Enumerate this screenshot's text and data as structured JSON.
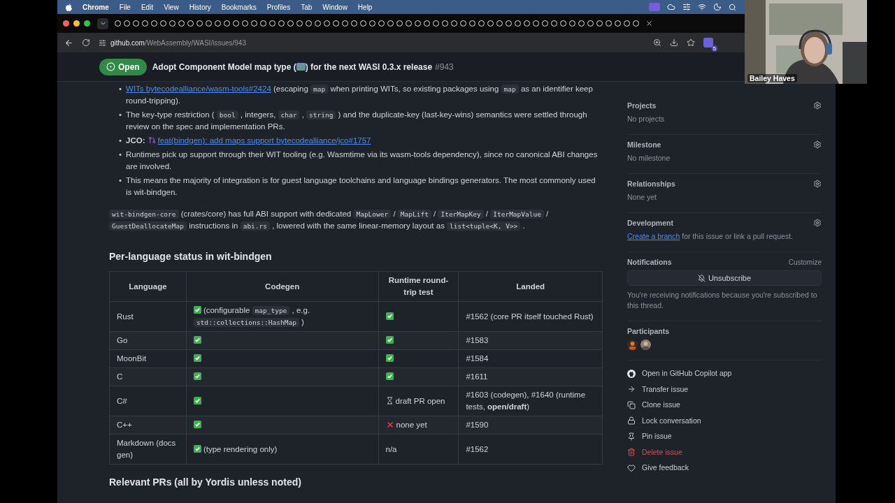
{
  "menubar": {
    "app": "Chrome",
    "menus": [
      "File",
      "Edit",
      "View",
      "History",
      "Bookmarks",
      "Profiles",
      "Tab",
      "Window",
      "Help"
    ]
  },
  "address_bar": {
    "host": "github.com",
    "path": "/WebAssembly/WASI/issues/943",
    "extension_badge": "5"
  },
  "issue": {
    "state": "Open",
    "title_start": "Adopt Component Model map type (",
    "title_end": ") for the next WASI 0.3.x release",
    "number": "#943"
  },
  "bullets": [
    {
      "marker": "•",
      "parts": [
        {
          "kind": "link",
          "text": "WITs bytecodealliance/wasm-tools#2424"
        },
        {
          "kind": "text",
          "text": " (escaping "
        },
        {
          "kind": "code",
          "text": "map"
        },
        {
          "kind": "text",
          "text": " when printing WITs, so existing packages using "
        },
        {
          "kind": "code",
          "text": "map"
        },
        {
          "kind": "text",
          "text": " as an identifier keep round-tripping)."
        }
      ]
    },
    {
      "marker": "•",
      "parts": [
        {
          "kind": "text",
          "text": "The key-type restriction ( "
        },
        {
          "kind": "code",
          "text": "bool"
        },
        {
          "kind": "text",
          "text": " , integers, "
        },
        {
          "kind": "code",
          "text": "char"
        },
        {
          "kind": "text",
          "text": " , "
        },
        {
          "kind": "code",
          "text": "string"
        },
        {
          "kind": "text",
          "text": " ) and the duplicate-key (last-key-wins) semantics were settled through review on the spec and implementation PRs."
        }
      ]
    },
    {
      "marker": "•",
      "parts": [
        {
          "kind": "bold",
          "text": "JCO:"
        },
        {
          "kind": "pr",
          "text": "feat(bindgen): add maps support bytecodealliance/jco#1757"
        }
      ]
    },
    {
      "marker": "•",
      "parts": [
        {
          "kind": "text",
          "text": "Runtimes pick up support through their WIT tooling (e.g. Wasmtime via its wasm-tools dependency), since no canonical ABI changes are involved."
        }
      ]
    },
    {
      "marker": "•",
      "parts": [
        {
          "kind": "text",
          "text": "This means the majority of integration is for guest language toolchains and language bindings generators. The most commonly used is wit-bindgen."
        }
      ]
    }
  ],
  "paragraph": [
    {
      "kind": "code",
      "text": "wit-bindgen-core"
    },
    {
      "kind": "text",
      "text": " (crates/core) has full ABI support with dedicated "
    },
    {
      "kind": "code",
      "text": "MapLower"
    },
    {
      "kind": "text",
      "text": " / "
    },
    {
      "kind": "code",
      "text": "MapLift"
    },
    {
      "kind": "text",
      "text": " / "
    },
    {
      "kind": "code",
      "text": "IterMapKey"
    },
    {
      "kind": "text",
      "text": " / "
    },
    {
      "kind": "code",
      "text": "IterMapValue"
    },
    {
      "kind": "text",
      "text": " / "
    },
    {
      "kind": "code",
      "text": "GuestDeallocateMap"
    },
    {
      "kind": "text",
      "text": " instructions in "
    },
    {
      "kind": "code",
      "text": "abi.rs"
    },
    {
      "kind": "text",
      "text": " , lowered with the same linear-memory layout as "
    },
    {
      "kind": "code",
      "text": "list<tuple<K, V>>"
    },
    {
      "kind": "text",
      "text": " ."
    }
  ],
  "section_heading": "Per-language status in wit-bindgen",
  "table": {
    "columns": [
      "Language",
      "Codegen",
      "Runtime round-trip test",
      "Landed"
    ],
    "rows": [
      {
        "cells": [
          {
            "kind": "plain",
            "parts": [
              {
                "kind": "text",
                "text": "Rust"
              }
            ]
          },
          {
            "kind": "check",
            "parts": [
              {
                "kind": "text",
                "text": "(configurable "
              },
              {
                "kind": "code",
                "text": "map_type"
              },
              {
                "kind": "text",
                "text": " , e.g. "
              },
              {
                "kind": "code",
                "text": "std::collections::HashMap"
              },
              {
                "kind": "text",
                "text": " )"
              }
            ]
          },
          {
            "kind": "check"
          },
          {
            "kind": "plain",
            "parts": [
              {
                "kind": "text",
                "text": "#1562 (core PR itself touched Rust)"
              }
            ]
          }
        ]
      },
      {
        "cells": [
          {
            "kind": "plain",
            "parts": [
              {
                "kind": "text",
                "text": "Go"
              }
            ]
          },
          {
            "kind": "check"
          },
          {
            "kind": "check"
          },
          {
            "kind": "plain",
            "parts": [
              {
                "kind": "text",
                "text": "#1583"
              }
            ]
          }
        ]
      },
      {
        "cells": [
          {
            "kind": "plain",
            "parts": [
              {
                "kind": "text",
                "text": "MoonBit"
              }
            ]
          },
          {
            "kind": "check"
          },
          {
            "kind": "check"
          },
          {
            "kind": "plain",
            "parts": [
              {
                "kind": "text",
                "text": "#1584"
              }
            ]
          }
        ]
      },
      {
        "cells": [
          {
            "kind": "plain",
            "parts": [
              {
                "kind": "text",
                "text": "C"
              }
            ]
          },
          {
            "kind": "check"
          },
          {
            "kind": "check"
          },
          {
            "kind": "plain",
            "parts": [
              {
                "kind": "text",
                "text": "#1611"
              }
            ]
          }
        ]
      },
      {
        "cells": [
          {
            "kind": "plain",
            "parts": [
              {
                "kind": "text",
                "text": "C#"
              }
            ]
          },
          {
            "kind": "check"
          },
          {
            "kind": "hourglass",
            "parts": [
              {
                "kind": "text",
                "text": "draft PR open"
              }
            ]
          },
          {
            "kind": "plain",
            "parts": [
              {
                "kind": "text",
                "text": "#1603 (codegen), #1640 (runtime tests, "
              },
              {
                "kind": "bold",
                "text": "open/draft"
              },
              {
                "kind": "text",
                "text": ")"
              }
            ]
          }
        ]
      },
      {
        "cells": [
          {
            "kind": "plain",
            "parts": [
              {
                "kind": "text",
                "text": "C++"
              }
            ]
          },
          {
            "kind": "check"
          },
          {
            "kind": "cross",
            "parts": [
              {
                "kind": "text",
                "text": "none yet"
              }
            ]
          },
          {
            "kind": "plain",
            "parts": [
              {
                "kind": "text",
                "text": "#1590"
              }
            ]
          }
        ]
      },
      {
        "cells": [
          {
            "kind": "plain",
            "parts": [
              {
                "kind": "text",
                "text": "Markdown (docs gen)"
              }
            ]
          },
          {
            "kind": "check",
            "parts": [
              {
                "kind": "text",
                "text": "(type rendering only)"
              }
            ]
          },
          {
            "kind": "plain",
            "parts": [
              {
                "kind": "text",
                "text": "n/a"
              }
            ]
          },
          {
            "kind": "plain",
            "parts": [
              {
                "kind": "text",
                "text": "#1562"
              }
            ]
          }
        ]
      }
    ]
  },
  "next_heading": "Relevant PRs (all by Yordis unless noted)",
  "sidebar": {
    "sections": [
      {
        "title": "Projects",
        "value": "No projects"
      },
      {
        "title": "Milestone",
        "value": "No milestone"
      },
      {
        "title": "Relationships",
        "value": "None yet"
      }
    ],
    "development": {
      "title": "Development",
      "link": "Create a branch",
      "text": "for this issue or link a pull request."
    },
    "notifications": {
      "title": "Notifications",
      "customize": "Customize",
      "button": "Unsubscribe",
      "note": "You're receiving notifications because you're subscribed to this thread."
    },
    "participants": {
      "title": "Participants"
    },
    "actions": [
      {
        "kind": "github",
        "label": "Open in GitHub Copilot app",
        "danger": false
      },
      {
        "kind": "transfer",
        "label": "Transfer issue",
        "danger": false
      },
      {
        "kind": "clone",
        "label": "Clone issue",
        "danger": false
      },
      {
        "kind": "lock",
        "label": "Lock conversation",
        "danger": false
      },
      {
        "kind": "pin",
        "label": "Pin issue",
        "danger": false
      },
      {
        "kind": "delete",
        "label": "Delete issue",
        "danger": true
      },
      {
        "kind": "feedback",
        "label": "Give feedback",
        "danger": false
      }
    ]
  },
  "video": {
    "name": "Bailey Haves"
  }
}
